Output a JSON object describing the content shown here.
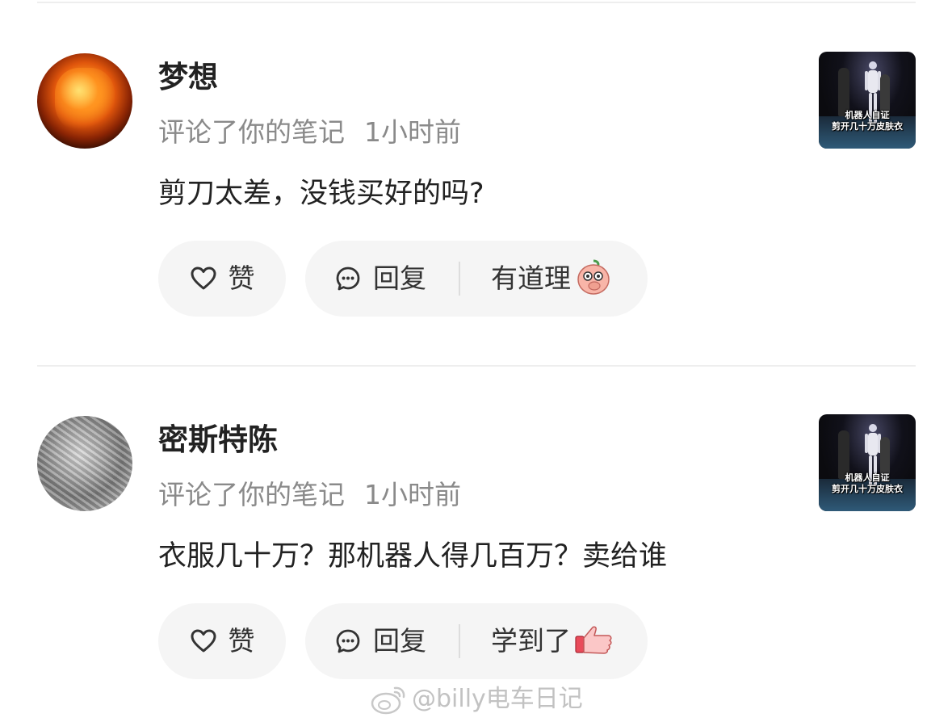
{
  "comments": [
    {
      "username": "梦想",
      "action": "评论了你的笔记",
      "time": "1小时前",
      "content": "剪刀太差，没钱买好的吗?",
      "like_label": "赞",
      "reply_label": "回复",
      "reaction_label": "有道理",
      "reaction_emoji": "thinking-peach-emoji",
      "avatar": "fire-fist-avatar",
      "thumbnail_caption_line1": "机器人自证",
      "thumbnail_caption_line2": "剪开几十万皮肤衣"
    },
    {
      "username": "密斯特陈",
      "action": "评论了你的笔记",
      "time": "1小时前",
      "content": "衣服几十万？那机器人得几百万？卖给谁",
      "like_label": "赞",
      "reply_label": "回复",
      "reaction_label": "学到了",
      "reaction_emoji": "thumbs-up-emoji",
      "avatar": "gray-texture-avatar",
      "thumbnail_caption_line1": "机器人自证",
      "thumbnail_caption_line2": "剪开几十万皮肤衣"
    }
  ],
  "watermark": "@billy电车日记",
  "icons": {
    "like": "heart-outline-icon",
    "reply": "speech-bubble-icon",
    "watermark": "weibo-logo-icon"
  },
  "colors": {
    "text_primary": "#222222",
    "text_secondary": "#8a8a8a",
    "pill_background": "#f5f5f5",
    "divider": "#eeeeee",
    "watermark": "#c2c2c2"
  }
}
